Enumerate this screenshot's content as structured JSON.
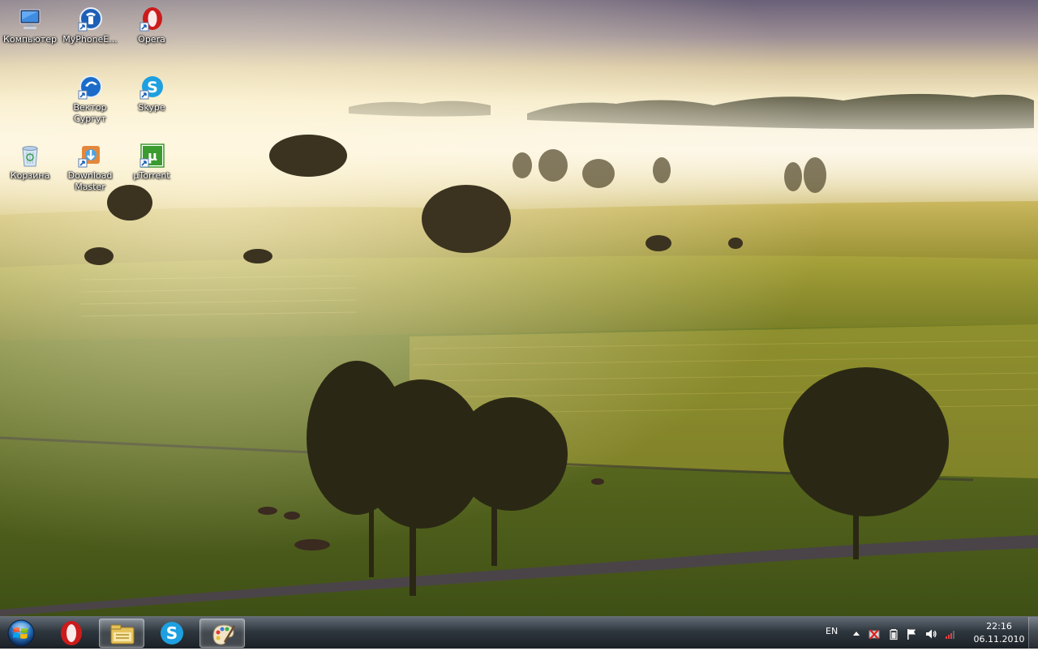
{
  "desktop": {
    "icons": [
      {
        "label": "Компьютер",
        "icon": "computer-icon"
      },
      {
        "label": "MyPhoneE...",
        "icon": "myphoneexplorer-icon"
      },
      {
        "label": "Opera",
        "icon": "opera-icon"
      },
      {
        "label": "Вектор Сургут",
        "icon": "vector-surgut-icon"
      },
      {
        "label": "Skype",
        "icon": "skype-icon"
      },
      {
        "label": "Корзина",
        "icon": "recycle-bin-icon"
      },
      {
        "label": "Download Master",
        "icon": "download-master-icon"
      },
      {
        "label": "µTorrent",
        "icon": "utorrent-icon"
      }
    ]
  },
  "taskbar": {
    "start": {
      "icon": "windows-start-icon"
    },
    "pinned": [
      {
        "icon": "opera-icon",
        "active": false
      },
      {
        "icon": "windows-explorer-icon",
        "active": true
      },
      {
        "icon": "skype-icon",
        "active": false
      },
      {
        "icon": "paint-icon",
        "active": true
      }
    ],
    "tray": {
      "language": "EN",
      "icons": [
        "show-hidden-icons-arrow-icon",
        "network-blocked-icon",
        "battery-icon",
        "action-center-flag-icon",
        "volume-icon",
        "signal-strength-icon"
      ],
      "time": "22:16",
      "date": "06.11.2010"
    }
  },
  "colors": {
    "opera_red": "#cc1b1b",
    "skype_blue": "#1ea0e0",
    "utorrent_green": "#3a9b2f"
  }
}
